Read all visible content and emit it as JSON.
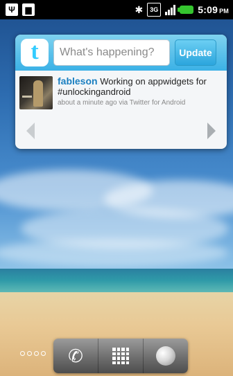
{
  "status_bar": {
    "time": "5:09",
    "time_suffix": "PM",
    "network_label": "3G",
    "left_icons": [
      "usb-icon",
      "sd-card-icon"
    ],
    "right_icons": [
      "bluetooth-icon",
      "network-3g-icon",
      "signal-strength-icon",
      "battery-icon"
    ]
  },
  "widget": {
    "logo_glyph": "t",
    "compose_placeholder": "What's happening?",
    "update_label": "Update",
    "tweet": {
      "user": "fableson",
      "text": "Working on appwidgets for #unlockingandroid",
      "meta": "about a minute ago via Twitter for Android"
    }
  },
  "dock": {
    "items": [
      "phone-icon",
      "app-launcher-icon",
      "browser-icon"
    ]
  },
  "colors": {
    "twitter_blue": "#3bb1e6",
    "username_blue": "#1a7fc0",
    "battery_green": "#35c52f"
  }
}
